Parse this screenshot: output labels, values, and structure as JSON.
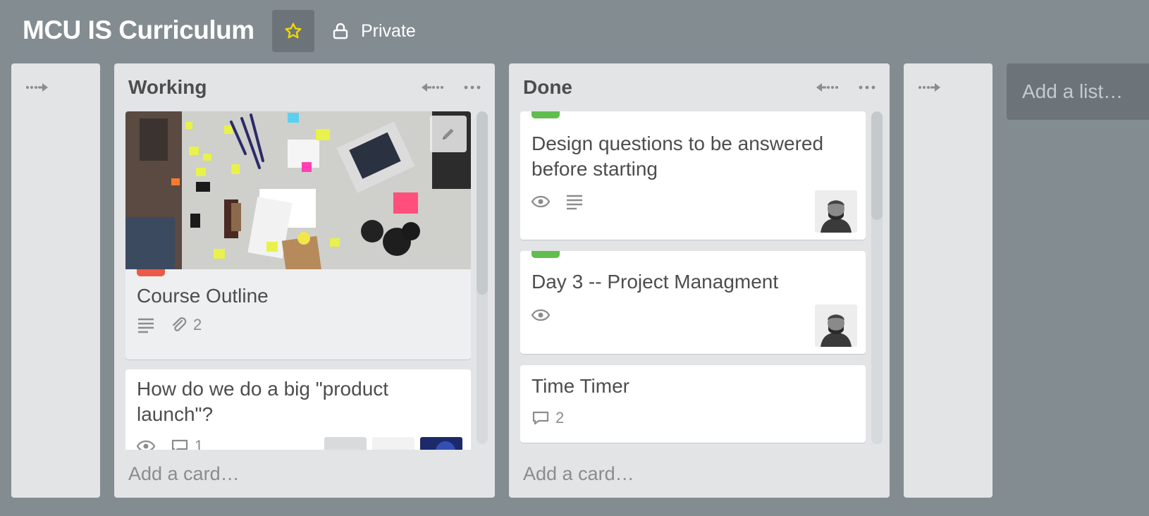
{
  "board": {
    "title": "MCU IS Curriculum",
    "star_icon": "star-icon",
    "visibility_label": "Private",
    "visibility_icon": "lock-icon"
  },
  "lists": {
    "working": {
      "title": "Working",
      "add_card": "Add a card…",
      "cards": [
        {
          "cover": "photo of a workshop table with sticky notes, markers and laptops",
          "label_color": "#eb5a46",
          "title": "Course Outline",
          "attachments": "2"
        },
        {
          "title": "How do we do a big \"product launch\"?",
          "comments": "1"
        }
      ]
    },
    "done": {
      "title": "Done",
      "add_card": "Add a card…",
      "cards": [
        {
          "label_color": "#61bd4f",
          "title": "Design questions to be answered before starting"
        },
        {
          "label_color": "#61bd4f",
          "title": "Day 3 -- Project Managment"
        },
        {
          "title": "Time Timer",
          "comments": "2"
        }
      ]
    }
  },
  "add_list": "Add a list…",
  "colors": {
    "background": "#838c91",
    "list": "#e2e4e6",
    "star": "#f2d600"
  }
}
